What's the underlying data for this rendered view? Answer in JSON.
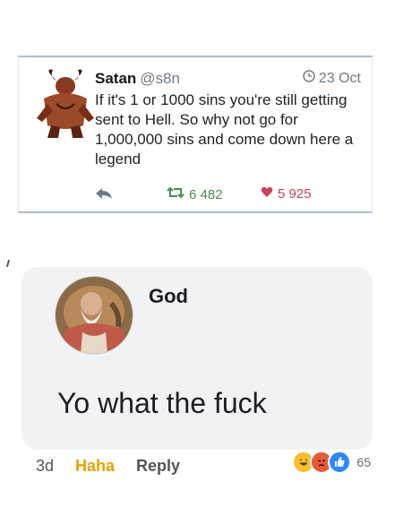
{
  "tweet": {
    "author_name": "Satan",
    "handle": "@s8n",
    "date": "23 Oct",
    "text": "If it's 1 or 1000 sins you're still getting sent to Hell. So why not go for 1,000,000 sins and come down here a legend",
    "retweets": "6 482",
    "likes": "5 925",
    "icons": {
      "reply": "reply-icon",
      "retweet": "retweet-icon",
      "like": "heart-icon",
      "date": "clock-icon"
    },
    "colors": {
      "retweet": "#4a8b50",
      "like": "#c4445a",
      "divider": "#a7bfd3"
    }
  },
  "comment": {
    "author_name": "God",
    "text": "Yo what the fuck",
    "time": "3d",
    "reaction_action": "Haha",
    "reply_action": "Reply",
    "reaction_count": "65",
    "reaction_icons": [
      "haha-icon",
      "angry-icon",
      "like-icon"
    ],
    "colors": {
      "haha": "#e8a200",
      "bubble": "#f1f2f4"
    }
  }
}
